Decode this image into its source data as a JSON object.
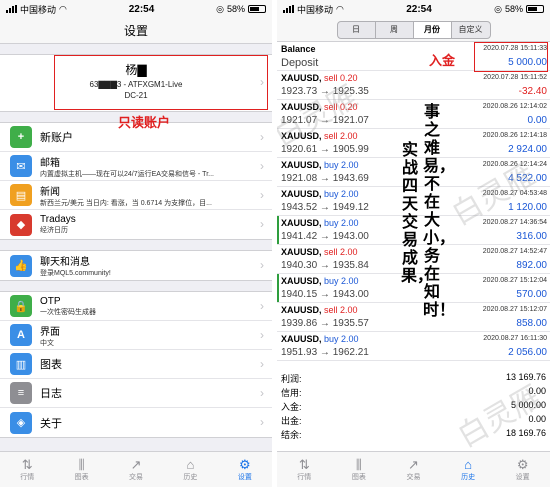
{
  "status": {
    "carrier": "中国移动",
    "time": "22:54",
    "battery": "58%"
  },
  "left": {
    "title": "设置",
    "account": {
      "name": "杨▇",
      "server": "63▇▇▇3 - ATFXGM1-Live",
      "dc": "DC-21"
    },
    "annotation": "只读账户",
    "rows_a": [
      {
        "icon": "add-account-icon",
        "color": "#3fae49",
        "glyph": "+",
        "title": "新账户",
        "sub": ""
      },
      {
        "icon": "mail-icon",
        "color": "#3a8ee6",
        "glyph": "✉",
        "title": "邮箱",
        "sub": "内置虚拟主机——现在可以24/7运行EA交易和信号 - Tr..."
      },
      {
        "icon": "news-icon",
        "color": "#f0a020",
        "glyph": "▤",
        "title": "新闻",
        "sub": "新西兰元/美元 当日内: 看涨，当 0.6714 为支撑位，目..."
      },
      {
        "icon": "tradays-icon",
        "color": "#d83a2e",
        "glyph": "◆",
        "title": "Tradays",
        "sub": "经济日历"
      }
    ],
    "rows_b": [
      {
        "icon": "chat-icon",
        "color": "#3a8ee6",
        "glyph": "👍",
        "title": "聊天和消息",
        "sub": "登录MQL5.community!"
      }
    ],
    "rows_c": [
      {
        "icon": "otp-icon",
        "color": "#3fae49",
        "glyph": "🔒",
        "title": "OTP",
        "sub": "一次性密码生成器"
      },
      {
        "icon": "interface-icon",
        "color": "#3a8ee6",
        "glyph": "A",
        "title": "界面",
        "sub": "中文"
      },
      {
        "icon": "charts-icon",
        "color": "#3a8ee6",
        "glyph": "▥",
        "title": "图表",
        "sub": ""
      },
      {
        "icon": "journal-icon",
        "color": "#8e8e93",
        "glyph": "≡",
        "title": "日志",
        "sub": ""
      },
      {
        "icon": "about-icon",
        "color": "#3a8ee6",
        "glyph": "◈",
        "title": "关于",
        "sub": ""
      }
    ],
    "tabs": [
      {
        "label": "行情",
        "glyph": "⇅",
        "active": false
      },
      {
        "label": "图表",
        "glyph": "⫼",
        "active": false
      },
      {
        "label": "交易",
        "glyph": "↗",
        "active": false
      },
      {
        "label": "历史",
        "glyph": "⌂",
        "active": false
      },
      {
        "label": "设置",
        "glyph": "⚙",
        "active": true
      }
    ]
  },
  "right": {
    "segments": [
      "日",
      "周",
      "月份",
      "自定义"
    ],
    "active_segment": "月份",
    "balance": {
      "title": "Balance",
      "sub": "Deposit",
      "date": "2020.07.28 15:11:33",
      "amount": "5 000.00"
    },
    "annotation_deposit": "入金",
    "deals": [
      {
        "sym": "XAUUSD,",
        "dir": "sell 0.20",
        "side": "sell",
        "price": "1923.73 → 1925.35",
        "date": "2020.07.28 15:11:52",
        "pl": "-32.40",
        "mark": false
      },
      {
        "sym": "XAUUSD,",
        "dir": "sell 0.20",
        "side": "sell",
        "price": "1921.07 → 1921.07",
        "date": "2020.08.26 12:14:02",
        "pl": "0.00",
        "mark": false
      },
      {
        "sym": "XAUUSD,",
        "dir": "sell 2.00",
        "side": "sell",
        "price": "1920.61 → 1905.99",
        "date": "2020.08.26 12:14:18",
        "pl": "2 924.00",
        "mark": false
      },
      {
        "sym": "XAUUSD,",
        "dir": "buy 2.00",
        "side": "buy",
        "price": "1921.08 → 1943.69",
        "date": "2020.08.26 12:14:24",
        "pl": "4 522.00",
        "mark": false
      },
      {
        "sym": "XAUUSD,",
        "dir": "buy 2.00",
        "side": "buy",
        "price": "1943.52 → 1949.12",
        "date": "2020.08.27 04:53:48",
        "pl": "1 120.00",
        "mark": false
      },
      {
        "sym": "XAUUSD,",
        "dir": "buy 2.00",
        "side": "buy",
        "price": "1941.42 → 1943.00",
        "date": "2020.08.27 14:36:54",
        "pl": "316.00",
        "mark": true
      },
      {
        "sym": "XAUUSD,",
        "dir": "sell 2.00",
        "side": "sell",
        "price": "1940.30 → 1935.84",
        "date": "2020.08.27 14:52:47",
        "pl": "892.00",
        "mark": false
      },
      {
        "sym": "XAUUSD,",
        "dir": "buy 2.00",
        "side": "buy",
        "price": "1940.15 → 1943.00",
        "date": "2020.08.27 15:12:04",
        "pl": "570.00",
        "mark": true
      },
      {
        "sym": "XAUUSD,",
        "dir": "sell 2.00",
        "side": "sell",
        "price": "1939.86 → 1935.57",
        "date": "2020.08.27 15:12:07",
        "pl": "858.00",
        "mark": false
      },
      {
        "sym": "XAUUSD,",
        "dir": "buy 2.00",
        "side": "buy",
        "price": "1951.93 → 1962.21",
        "date": "2020.08.27 16:11:30",
        "pl": "2 056.00",
        "mark": false
      }
    ],
    "summary": [
      {
        "label": "利润:",
        "value": "13 169.76"
      },
      {
        "label": "信用:",
        "value": "0.00"
      },
      {
        "label": "入金:",
        "value": "5 000.00"
      },
      {
        "label": "出金:",
        "value": "0.00"
      },
      {
        "label": "结余:",
        "value": "18 169.76"
      }
    ],
    "overlay_col1": "事之难易，不在大小，务在知时！",
    "overlay_col2": "实战四天交易成果，",
    "watermark": "白灵雁",
    "tabs": [
      {
        "label": "行情",
        "glyph": "⇅",
        "active": false
      },
      {
        "label": "图表",
        "glyph": "⫼",
        "active": false
      },
      {
        "label": "交易",
        "glyph": "↗",
        "active": false
      },
      {
        "label": "历史",
        "glyph": "⌂",
        "active": true
      },
      {
        "label": "设置",
        "glyph": "⚙",
        "active": false
      }
    ]
  }
}
